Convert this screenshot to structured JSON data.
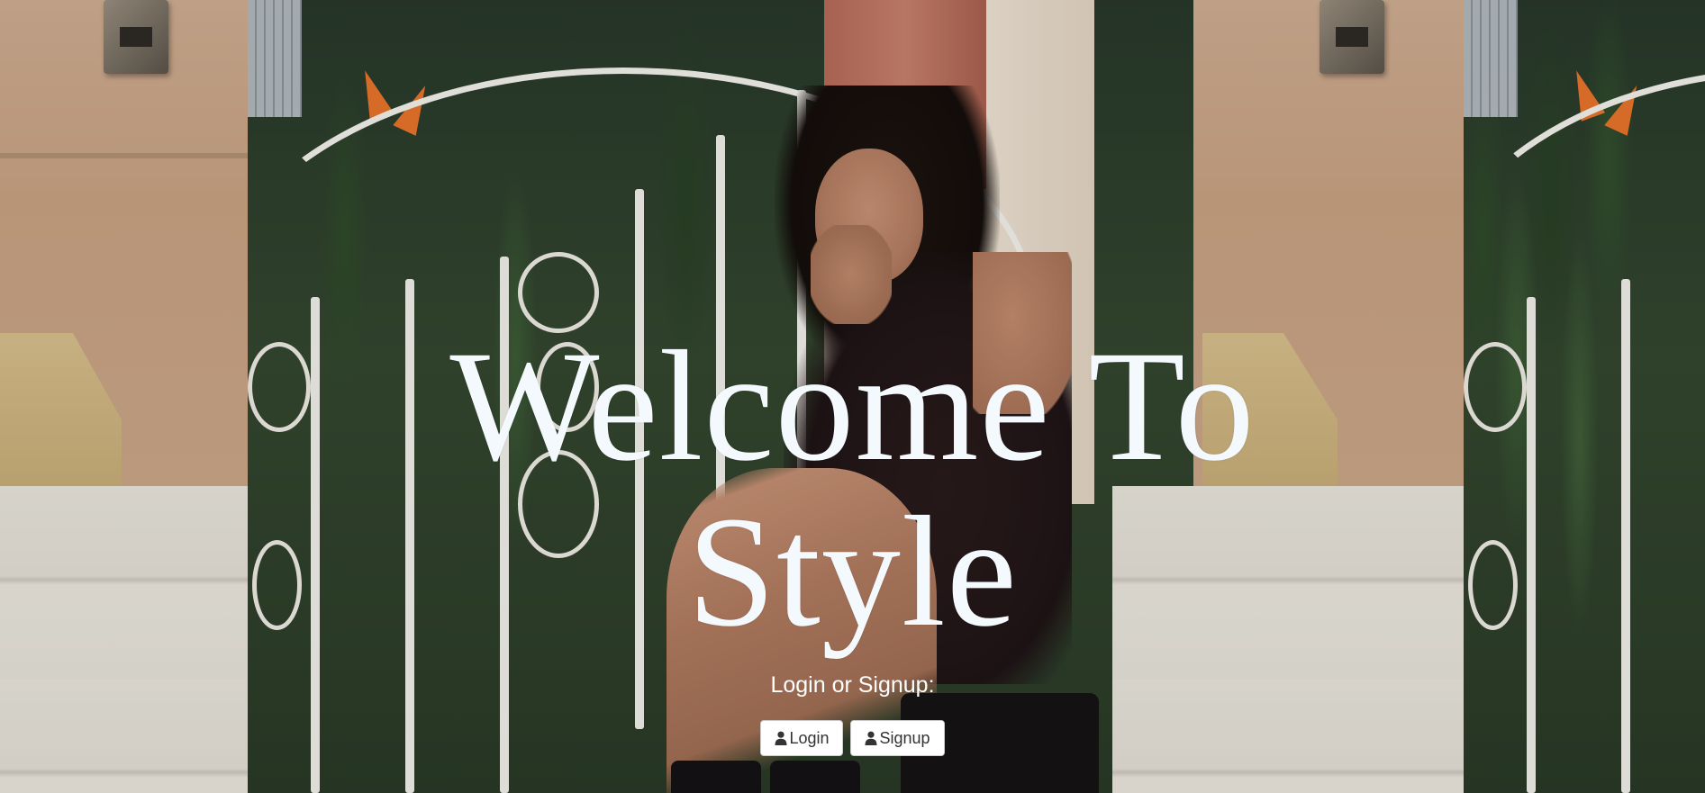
{
  "hero": {
    "title_line1": "Welcome To",
    "title_line2": "Style",
    "subtitle": "Login or Signup:"
  },
  "buttons": {
    "login": {
      "label": "Login",
      "icon": "user-icon"
    },
    "signup": {
      "label": "Signup",
      "icon": "user-icon"
    }
  },
  "colors": {
    "title": "#f4f9fd",
    "button_bg": "#ffffff",
    "button_text": "#333333"
  }
}
